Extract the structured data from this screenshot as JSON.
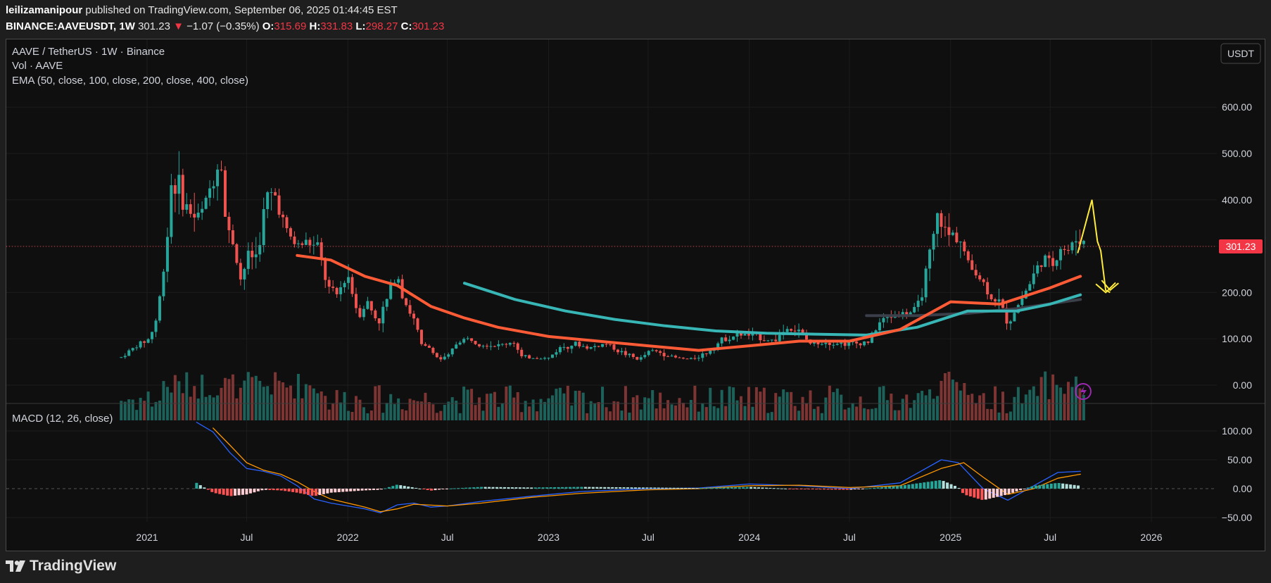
{
  "header": {
    "publisher": "leilizamanipour",
    "published_text": "published on TradingView.com, September 06, 2025 01:44:45 EST",
    "symbol": "BINANCE:AAVEUSDT, 1W",
    "last": "301.23",
    "down_arrow": "▼",
    "change": "−1.07 (−0.35%)",
    "o_label": "O:",
    "o_value": "315.69",
    "h_label": "H:",
    "h_value": "331.83",
    "l_label": "L:",
    "l_value": "298.27",
    "c_label": "C:",
    "c_value": "301.23"
  },
  "legend": {
    "title": "AAVE / TetherUS · 1W · Binance",
    "vol": "Vol · AAVE",
    "ema": "EMA (50, close, 100, close, 200, close, 400, close)",
    "macd": "MACD (12, 26, close)"
  },
  "currency_button": "USDT",
  "price_label": "301.23",
  "footer": {
    "brand": "TradingView",
    "logo_icon": "tradingview-logo-icon"
  },
  "colors": {
    "up": "#26a69a",
    "down": "#ef5350",
    "ema50": "#ff5b36",
    "ema100": "#38b6b6",
    "ema200": "#3a3f4a",
    "macd": "#2962ff",
    "signal": "#ff9800",
    "drawing": "#ffeb3b",
    "bg": "#0f0f0f"
  },
  "chart_data": {
    "type": "candlestick",
    "title": "AAVE / TetherUS · 1W · Binance",
    "x_ticks": [
      "2021",
      "Jul",
      "2022",
      "Jul",
      "2023",
      "Jul",
      "2024",
      "Jul",
      "2025",
      "Jul",
      "2026"
    ],
    "y_ticks": [
      "600.00",
      "500.00",
      "400.00",
      "300.00",
      "200.00",
      "100.00",
      "0.00"
    ],
    "ylim": [
      -35,
      660
    ],
    "macd_ticks": [
      "100.00",
      "50.00",
      "0.00",
      "−50.00"
    ],
    "macd_ylim": [
      -70,
      130
    ],
    "price_path": [
      [
        "2020-11-15",
        60
      ],
      [
        "2020-12-01",
        75
      ],
      [
        "2020-12-20",
        90
      ],
      [
        "2021-01-05",
        100
      ],
      [
        "2021-01-20",
        150
      ],
      [
        "2021-02-05",
        300
      ],
      [
        "2021-02-15",
        450
      ],
      [
        "2021-03-01",
        420
      ],
      [
        "2021-03-15",
        380
      ],
      [
        "2021-04-01",
        360
      ],
      [
        "2021-04-15",
        380
      ],
      [
        "2021-05-01",
        450
      ],
      [
        "2021-05-15",
        500
      ],
      [
        "2021-05-25",
        330
      ],
      [
        "2021-06-05",
        320
      ],
      [
        "2021-06-20",
        230
      ],
      [
        "2021-07-05",
        280
      ],
      [
        "2021-07-20",
        280
      ],
      [
        "2021-08-05",
        400
      ],
      [
        "2021-08-25",
        410
      ],
      [
        "2021-09-10",
        330
      ],
      [
        "2021-10-01",
        300
      ],
      [
        "2021-10-20",
        310
      ],
      [
        "2021-11-10",
        290
      ],
      [
        "2021-11-25",
        210
      ],
      [
        "2021-12-10",
        190
      ],
      [
        "2022-01-01",
        240
      ],
      [
        "2022-01-20",
        150
      ],
      [
        "2022-02-05",
        180
      ],
      [
        "2022-02-25",
        135
      ],
      [
        "2022-03-15",
        190
      ],
      [
        "2022-03-30",
        250
      ],
      [
        "2022-04-15",
        180
      ],
      [
        "2022-05-05",
        130
      ],
      [
        "2022-05-15",
        85
      ],
      [
        "2022-06-01",
        80
      ],
      [
        "2022-06-15",
        55
      ],
      [
        "2022-07-01",
        60
      ],
      [
        "2022-07-20",
        95
      ],
      [
        "2022-08-10",
        100
      ],
      [
        "2022-09-01",
        90
      ],
      [
        "2022-10-01",
        85
      ],
      [
        "2022-11-01",
        95
      ],
      [
        "2022-11-10",
        60
      ],
      [
        "2022-12-01",
        60
      ],
      [
        "2023-01-01",
        58
      ],
      [
        "2023-01-20",
        80
      ],
      [
        "2023-02-15",
        90
      ],
      [
        "2023-03-15",
        80
      ],
      [
        "2023-04-15",
        90
      ],
      [
        "2023-05-15",
        70
      ],
      [
        "2023-06-15",
        55
      ],
      [
        "2023-07-05",
        75
      ],
      [
        "2023-07-25",
        70
      ],
      [
        "2023-08-15",
        60
      ],
      [
        "2023-09-15",
        55
      ],
      [
        "2023-10-15",
        70
      ],
      [
        "2023-11-15",
        100
      ],
      [
        "2023-12-15",
        110
      ],
      [
        "2024-01-15",
        105
      ],
      [
        "2024-02-15",
        95
      ],
      [
        "2024-03-10",
        125
      ],
      [
        "2024-04-01",
        115
      ],
      [
        "2024-04-20",
        90
      ],
      [
        "2024-05-15",
        95
      ],
      [
        "2024-06-15",
        90
      ],
      [
        "2024-07-15",
        90
      ],
      [
        "2024-08-05",
        95
      ],
      [
        "2024-08-25",
        135
      ],
      [
        "2024-09-15",
        150
      ],
      [
        "2024-10-10",
        155
      ],
      [
        "2024-11-01",
        160
      ],
      [
        "2024-11-25",
        280
      ],
      [
        "2024-12-10",
        370
      ],
      [
        "2024-12-25",
        320
      ],
      [
        "2025-01-15",
        330
      ],
      [
        "2025-02-01",
        260
      ],
      [
        "2025-02-20",
        240
      ],
      [
        "2025-03-10",
        200
      ],
      [
        "2025-04-01",
        175
      ],
      [
        "2025-04-15",
        135
      ],
      [
        "2025-05-05",
        175
      ],
      [
        "2025-05-25",
        220
      ],
      [
        "2025-06-15",
        270
      ],
      [
        "2025-07-05",
        260
      ],
      [
        "2025-07-20",
        300
      ],
      [
        "2025-08-05",
        290
      ],
      [
        "2025-08-20",
        320
      ],
      [
        "2025-09-06",
        301.23
      ]
    ],
    "ema_red": [
      [
        "2021-10-01",
        280
      ],
      [
        "2021-12-01",
        270
      ],
      [
        "2022-02-01",
        235
      ],
      [
        "2022-04-01",
        215
      ],
      [
        "2022-06-01",
        170
      ],
      [
        "2022-08-01",
        145
      ],
      [
        "2022-10-01",
        125
      ],
      [
        "2023-01-01",
        105
      ],
      [
        "2023-04-01",
        95
      ],
      [
        "2023-07-01",
        85
      ],
      [
        "2023-10-01",
        75
      ],
      [
        "2024-01-01",
        85
      ],
      [
        "2024-04-01",
        95
      ],
      [
        "2024-07-01",
        95
      ],
      [
        "2024-10-01",
        120
      ],
      [
        "2025-01-01",
        180
      ],
      [
        "2025-04-01",
        175
      ],
      [
        "2025-07-01",
        210
      ],
      [
        "2025-08-25",
        235
      ]
    ],
    "ema_teal": [
      [
        "2022-08-01",
        220
      ],
      [
        "2022-11-01",
        185
      ],
      [
        "2023-02-01",
        160
      ],
      [
        "2023-05-01",
        142
      ],
      [
        "2023-08-01",
        128
      ],
      [
        "2023-11-01",
        117
      ],
      [
        "2024-02-01",
        112
      ],
      [
        "2024-05-01",
        110
      ],
      [
        "2024-08-01",
        108
      ],
      [
        "2024-11-01",
        125
      ],
      [
        "2025-02-01",
        160
      ],
      [
        "2025-05-01",
        160
      ],
      [
        "2025-07-01",
        175
      ],
      [
        "2025-08-25",
        195
      ]
    ],
    "ema_dark": [
      [
        "2024-08-01",
        150
      ],
      [
        "2024-11-01",
        150
      ],
      [
        "2025-02-01",
        155
      ],
      [
        "2025-05-01",
        165
      ],
      [
        "2025-08-25",
        185
      ]
    ],
    "macd_line": [
      [
        "2021-04-01",
        115
      ],
      [
        "2021-05-01",
        98
      ],
      [
        "2021-06-01",
        62
      ],
      [
        "2021-07-01",
        35
      ],
      [
        "2021-08-01",
        30
      ],
      [
        "2021-09-01",
        22
      ],
      [
        "2021-10-01",
        5
      ],
      [
        "2021-11-01",
        -18
      ],
      [
        "2021-12-01",
        -25
      ],
      [
        "2022-01-01",
        -30
      ],
      [
        "2022-02-01",
        -35
      ],
      [
        "2022-03-01",
        -42
      ],
      [
        "2022-04-01",
        -28
      ],
      [
        "2022-05-01",
        -25
      ],
      [
        "2022-06-01",
        -32
      ],
      [
        "2022-07-01",
        -30
      ],
      [
        "2022-09-01",
        -22
      ],
      [
        "2022-12-01",
        -13
      ],
      [
        "2023-03-01",
        -5
      ],
      [
        "2023-07-01",
        0
      ],
      [
        "2023-10-01",
        1
      ],
      [
        "2024-01-01",
        8
      ],
      [
        "2024-04-01",
        5
      ],
      [
        "2024-07-01",
        0
      ],
      [
        "2024-10-01",
        10
      ],
      [
        "2024-12-15",
        50
      ],
      [
        "2025-01-15",
        45
      ],
      [
        "2025-03-01",
        0
      ],
      [
        "2025-04-15",
        -20
      ],
      [
        "2025-06-01",
        5
      ],
      [
        "2025-07-15",
        28
      ],
      [
        "2025-08-25",
        30
      ]
    ],
    "signal_line": [
      [
        "2021-05-01",
        105
      ],
      [
        "2021-06-01",
        75
      ],
      [
        "2021-07-01",
        45
      ],
      [
        "2021-08-01",
        32
      ],
      [
        "2021-09-01",
        25
      ],
      [
        "2021-10-01",
        12
      ],
      [
        "2021-11-01",
        -5
      ],
      [
        "2021-12-01",
        -18
      ],
      [
        "2022-01-01",
        -25
      ],
      [
        "2022-02-01",
        -32
      ],
      [
        "2022-03-01",
        -40
      ],
      [
        "2022-04-01",
        -35
      ],
      [
        "2022-05-01",
        -27
      ],
      [
        "2022-07-01",
        -30
      ],
      [
        "2022-09-01",
        -25
      ],
      [
        "2022-12-01",
        -15
      ],
      [
        "2023-03-01",
        -8
      ],
      [
        "2023-07-01",
        -2
      ],
      [
        "2023-10-01",
        0
      ],
      [
        "2024-01-01",
        5
      ],
      [
        "2024-04-01",
        6
      ],
      [
        "2024-07-01",
        2
      ],
      [
        "2024-10-01",
        5
      ],
      [
        "2024-12-15",
        35
      ],
      [
        "2025-01-25",
        45
      ],
      [
        "2025-03-01",
        20
      ],
      [
        "2025-04-15",
        -10
      ],
      [
        "2025-06-01",
        0
      ],
      [
        "2025-07-15",
        18
      ],
      [
        "2025-08-25",
        25
      ]
    ],
    "annotation_arrow": [
      [
        "2025-08-20",
        285
      ],
      [
        "2025-09-15",
        400
      ],
      [
        "2025-09-25",
        310
      ],
      [
        "2025-10-01",
        290
      ],
      [
        "2025-10-10",
        205
      ],
      [
        "2025-10-18",
        200
      ]
    ]
  }
}
